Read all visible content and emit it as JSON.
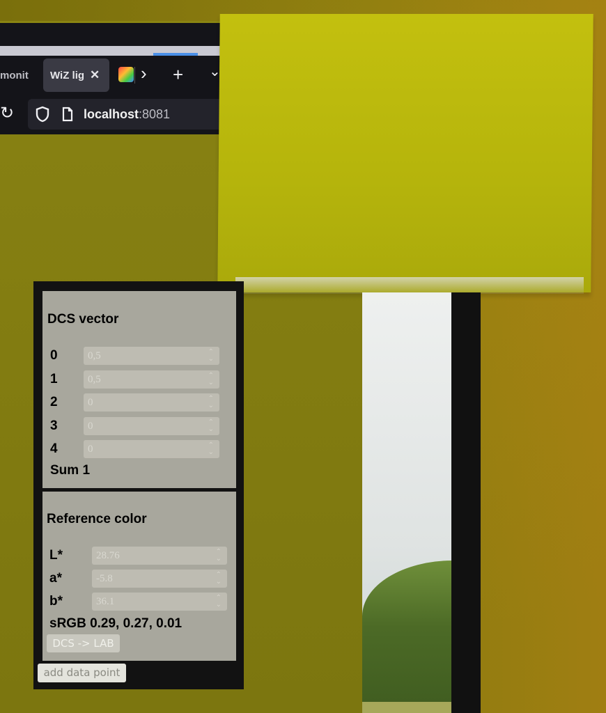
{
  "browser": {
    "tabs": [
      {
        "label": "monit"
      },
      {
        "label": "WiZ lig",
        "close": "✕"
      }
    ],
    "toolbar": {
      "forward": "›",
      "new_tab": "+",
      "list": "⌄",
      "reload": "↻"
    },
    "url": {
      "host": "localhost",
      "port": ":8081"
    }
  },
  "dcs": {
    "title": "DCS vector",
    "rows": [
      {
        "label": "0",
        "value": "0,5"
      },
      {
        "label": "1",
        "value": "0,5"
      },
      {
        "label": "2",
        "value": "0"
      },
      {
        "label": "3",
        "value": "0"
      },
      {
        "label": "4",
        "value": "0"
      }
    ],
    "sum": "Sum 1"
  },
  "reference": {
    "title": "Reference color",
    "rows": [
      {
        "label": "L*",
        "value": "28.76"
      },
      {
        "label": "a*",
        "value": "-5.8"
      },
      {
        "label": "b*",
        "value": "36.1"
      }
    ],
    "srgb": "sRGB 0.29, 0.27, 0.01",
    "convert_button": "DCS -> LAB"
  },
  "actions": {
    "add_data_point": "add data point"
  },
  "colors": {
    "sticky_note": "#bdbb0e",
    "panel_bg": "#a8a79d",
    "browser_chrome": "#141419"
  }
}
